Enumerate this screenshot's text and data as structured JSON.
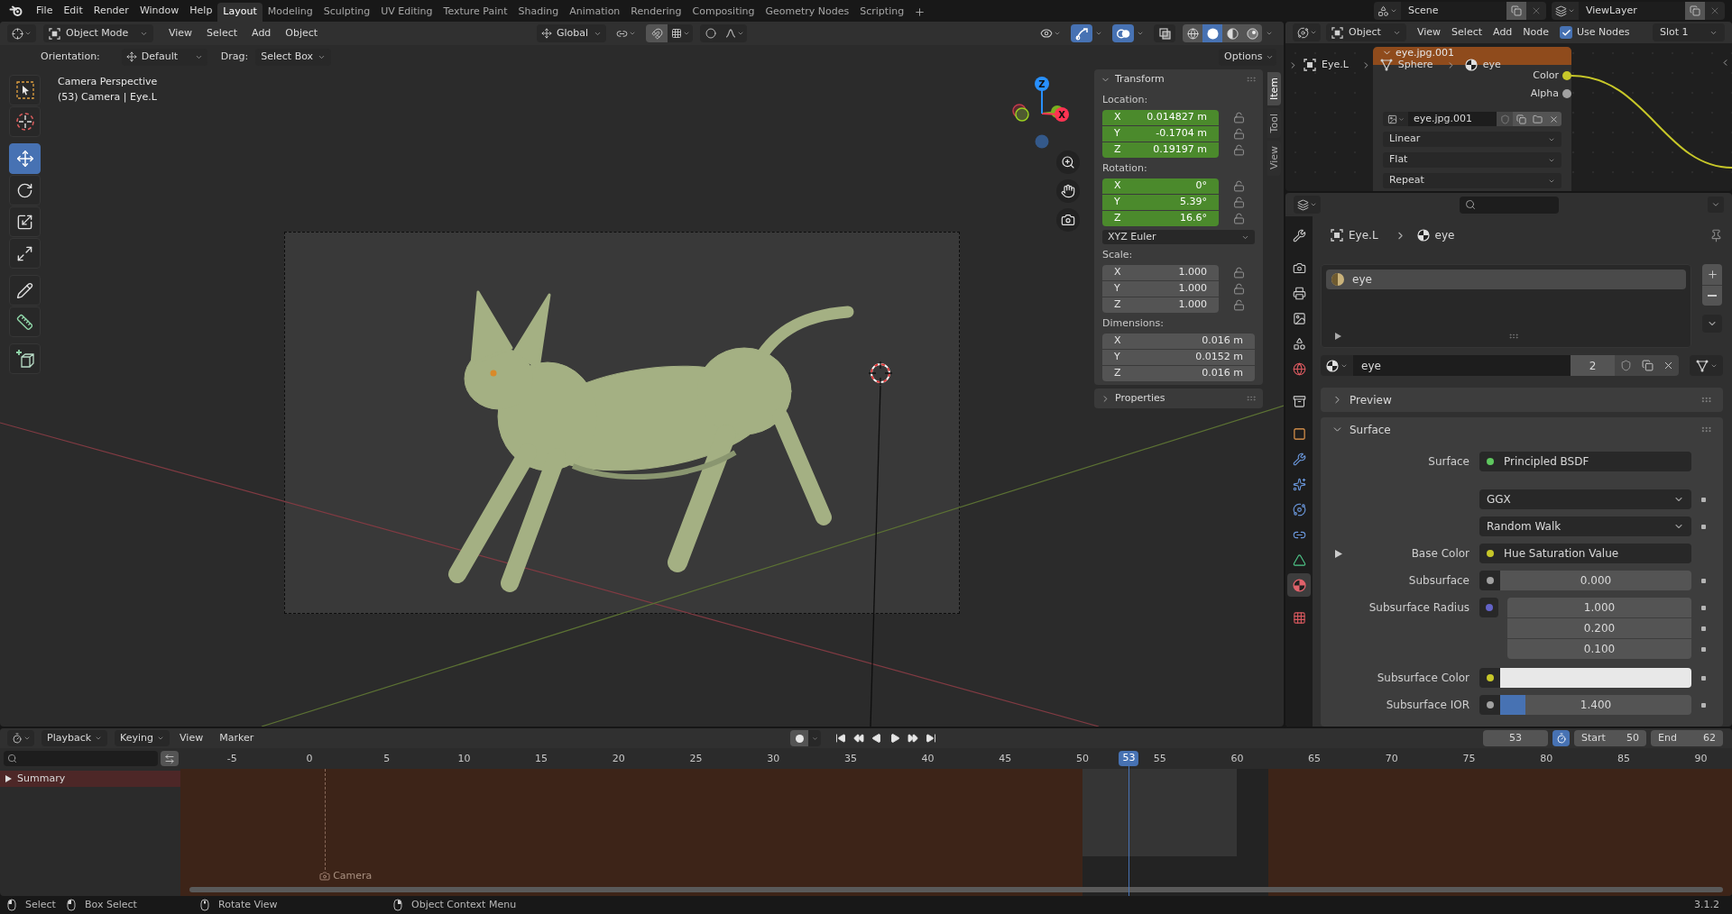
{
  "top_bar": {
    "menus": [
      "File",
      "Edit",
      "Render",
      "Window",
      "Help"
    ],
    "workspaces": [
      {
        "label": "Layout",
        "selected": true
      },
      {
        "label": "Modeling",
        "selected": false
      },
      {
        "label": "Sculpting",
        "selected": false
      },
      {
        "label": "UV Editing",
        "selected": false
      },
      {
        "label": "Texture Paint",
        "selected": false
      },
      {
        "label": "Shading",
        "selected": false
      },
      {
        "label": "Animation",
        "selected": false
      },
      {
        "label": "Rendering",
        "selected": false
      },
      {
        "label": "Compositing",
        "selected": false
      },
      {
        "label": "Geometry Nodes",
        "selected": false
      },
      {
        "label": "Scripting",
        "selected": false
      }
    ],
    "scene": "Scene",
    "view_layer": "ViewLayer"
  },
  "viewport": {
    "header": {
      "mode": "Object Mode",
      "menus": [
        "View",
        "Select",
        "Add",
        "Object"
      ],
      "orientation": "Global",
      "toggles": [
        {
          "kind": "gizmos",
          "on": true
        },
        {
          "kind": "overlays",
          "on": true
        },
        {
          "kind": "xray",
          "on": false
        }
      ],
      "shading": [
        {
          "kind": "wireframe",
          "selected": false
        },
        {
          "kind": "solid",
          "selected": true
        },
        {
          "kind": "material",
          "selected": false
        },
        {
          "kind": "rendered",
          "selected": false
        }
      ]
    },
    "tool_settings": {
      "orientation_label": "Orientation:",
      "orientation": "Default",
      "drag_label": "Drag:",
      "drag": "Select Box",
      "options": "Options"
    },
    "toolbar": [
      [
        {
          "kind": "select_box",
          "selected": false
        },
        {
          "kind": "cursor",
          "selected": false
        }
      ],
      [
        {
          "kind": "move",
          "selected": true
        },
        {
          "kind": "rotate",
          "selected": false
        },
        {
          "kind": "scale",
          "selected": false
        },
        {
          "kind": "transform",
          "selected": false
        }
      ],
      [
        {
          "kind": "annotate",
          "selected": false
        },
        {
          "kind": "measure",
          "selected": false
        }
      ],
      [
        {
          "kind": "add_cube",
          "selected": false
        }
      ]
    ],
    "view_name": "Camera Perspective",
    "object_info": "(53) Camera | Eye.L",
    "gizmo_axes": [
      "X",
      "Z"
    ]
  },
  "sidebar": {
    "tabs": [
      {
        "label": "Item",
        "selected": true
      },
      {
        "label": "Tool",
        "selected": false
      },
      {
        "label": "View",
        "selected": false
      }
    ],
    "panels": [
      {
        "title": "Transform",
        "expanded": true,
        "groups": [
          {
            "kind": "vector_lock",
            "label": "Location:",
            "keyed": true,
            "fields": [
              {
                "axis": "X",
                "value": "0.014827 m"
              },
              {
                "axis": "Y",
                "value": "-0.1704 m"
              },
              {
                "axis": "Z",
                "value": "0.19197 m"
              }
            ]
          },
          {
            "kind": "vector_lock",
            "label": "Rotation:",
            "keyed": true,
            "fields": [
              {
                "axis": "X",
                "value": "0°"
              },
              {
                "axis": "Y",
                "value": "5.39°"
              },
              {
                "axis": "Z",
                "value": "16.6°"
              }
            ]
          },
          {
            "kind": "dropdown",
            "value": "XYZ Euler"
          },
          {
            "kind": "vector_lock",
            "label": "Scale:",
            "keyed": false,
            "fields": [
              {
                "axis": "X",
                "value": "1.000"
              },
              {
                "axis": "Y",
                "value": "1.000"
              },
              {
                "axis": "Z",
                "value": "1.000"
              }
            ]
          },
          {
            "kind": "vector",
            "label": "Dimensions:",
            "keyed": false,
            "fields": [
              {
                "axis": "X",
                "value": "0.016 m"
              },
              {
                "axis": "Y",
                "value": "0.0152 m"
              },
              {
                "axis": "Z",
                "value": "0.016 m"
              }
            ]
          }
        ]
      },
      {
        "title": "Properties",
        "expanded": false
      }
    ]
  },
  "node_editor": {
    "header": {
      "data_type": "Object",
      "menus": [
        "View",
        "Select",
        "Add",
        "Node"
      ],
      "use_nodes": {
        "label": "Use Nodes",
        "checked": true
      },
      "slot": "Slot 1"
    },
    "breadcrumbs": [
      {
        "kind": "object",
        "label": "Eye.L"
      },
      {
        "kind": "mesh",
        "label": "Sphere"
      },
      {
        "kind": "material",
        "label": "eye"
      }
    ],
    "node": {
      "title": "eye.jpg.001",
      "outputs": [
        {
          "label": "Color",
          "color": "#c7c729"
        },
        {
          "label": "Alpha",
          "color": "#a1a1a1"
        }
      ],
      "image": "eye.jpg.001",
      "options": [
        "Linear",
        "Flat",
        "Repeat"
      ]
    }
  },
  "properties": {
    "tabs": [
      [
        {
          "kind": "tool",
          "selected": false
        }
      ],
      [
        {
          "kind": "render",
          "selected": false
        },
        {
          "kind": "output",
          "selected": false
        },
        {
          "kind": "view_layer",
          "selected": false
        },
        {
          "kind": "scene",
          "selected": false
        },
        {
          "kind": "world",
          "selected": false
        }
      ],
      [
        {
          "kind": "collection",
          "selected": false
        }
      ],
      [
        {
          "kind": "object",
          "selected": false
        },
        {
          "kind": "modifiers",
          "selected": false
        },
        {
          "kind": "particles",
          "selected": false
        },
        {
          "kind": "physics",
          "selected": false
        },
        {
          "kind": "constraints",
          "selected": false
        },
        {
          "kind": "data",
          "selected": false
        },
        {
          "kind": "material",
          "selected": true
        }
      ],
      [
        {
          "kind": "texture",
          "selected": false
        }
      ]
    ],
    "breadcrumbs": [
      {
        "kind": "object",
        "label": "Eye.L"
      },
      {
        "kind": "material",
        "label": "eye"
      }
    ],
    "material_slots": [
      {
        "label": "eye",
        "selected": true
      }
    ],
    "material": {
      "name": "eye",
      "users": "2"
    },
    "panels": [
      {
        "title": "Preview",
        "expanded": false
      },
      {
        "title": "Surface",
        "expanded": true,
        "rows": [
          {
            "kind": "link",
            "label": "Surface",
            "value": "Principled BSDF",
            "color": "#5fc75f",
            "expandable": false
          },
          {
            "kind": "dropdown",
            "value": "GGX",
            "expandable": false
          },
          {
            "kind": "dropdown",
            "value": "Random Walk",
            "expandable": false
          },
          {
            "kind": "link",
            "label": "Base Color",
            "value": "Hue Saturation Value",
            "color": "#c7c729",
            "expandable": true
          },
          {
            "kind": "number",
            "label": "Subsurface",
            "value": "0.000",
            "color": "#a1a1a1",
            "expandable": false
          },
          {
            "kind": "vector",
            "label": "Subsurface Radius",
            "values": [
              "1.000",
              "0.200",
              "0.100"
            ],
            "color": "#6363c7",
            "expandable": false
          },
          {
            "kind": "color",
            "label": "Subsurface Color",
            "color": "#c7c729",
            "expandable": false
          },
          {
            "kind": "slider",
            "label": "Subsurface IOR",
            "value": "1.400",
            "level": 0.13,
            "color": "#a1a1a1",
            "expandable": false
          }
        ]
      }
    ]
  },
  "timeline": {
    "menus": [
      {
        "kind": "dropdown",
        "label": "Playback"
      },
      {
        "kind": "dropdown",
        "label": "Keying"
      },
      {
        "kind": "menu",
        "label": "View"
      },
      {
        "kind": "menu",
        "label": "Marker"
      }
    ],
    "current_frame": "53",
    "preview_range": true,
    "start_label": "Start",
    "start": "50",
    "end_label": "End",
    "end": "62",
    "ruler_ticks": [
      "-5",
      "0",
      "5",
      "10",
      "15",
      "20",
      "25",
      "30",
      "35",
      "40",
      "45",
      "50",
      "55",
      "60",
      "65",
      "70",
      "75",
      "80",
      "85",
      "90"
    ],
    "playhead": "53",
    "channels": [
      {
        "label": "Summary",
        "expanded": false
      }
    ],
    "markers": [
      {
        "label": "Camera"
      }
    ]
  },
  "status_bar": {
    "hints": [
      {
        "kind": "left_click",
        "label": "Select"
      },
      {
        "kind": "left_drag",
        "label": "Box Select"
      },
      {
        "kind": "middle_drag",
        "label": "Rotate View"
      },
      {
        "kind": "right_click",
        "label": "Object Context Menu"
      }
    ],
    "version": "3.1.2"
  }
}
